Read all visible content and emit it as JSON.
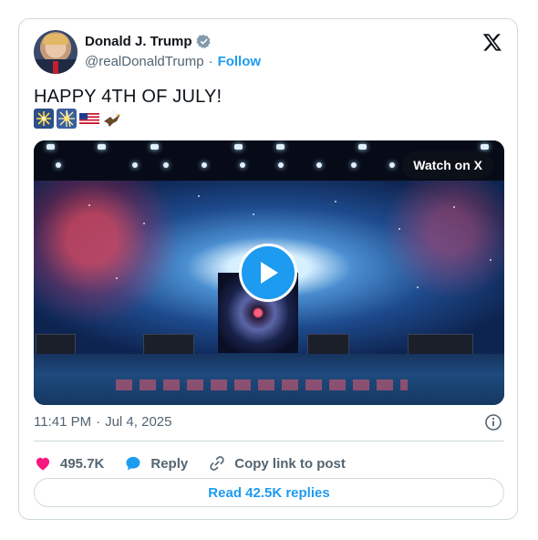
{
  "author": {
    "name": "Donald J. Trump",
    "handle": "@realDonaldTrump",
    "separator": "·",
    "follow_label": "Follow"
  },
  "post": {
    "text": "HAPPY 4TH OF JULY!",
    "emojis": [
      "fireworks-sparkler-icon",
      "fireworks-icon",
      "us-flag-icon",
      "eagle-icon"
    ]
  },
  "media": {
    "watch_label": "Watch on X"
  },
  "meta": {
    "time": "11:41 PM",
    "separator": "·",
    "date": "Jul 4, 2025"
  },
  "actions": {
    "likes": "495.7K",
    "reply_label": "Reply",
    "copy_label": "Copy link to post"
  },
  "replies_button": "Read 42.5K replies",
  "colors": {
    "accent": "#1d9bf0",
    "like": "#f91880",
    "muted": "#536471",
    "border": "#cfd9de"
  }
}
